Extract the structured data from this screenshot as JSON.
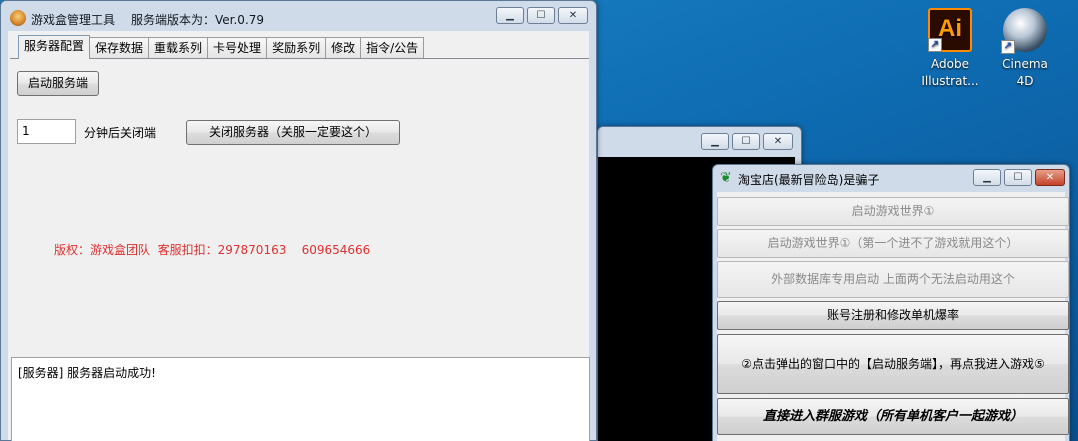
{
  "desktop": {
    "icons": [
      {
        "label": "Adobe Illustrat...",
        "glyph": "Ai"
      },
      {
        "label": "Cinema 4D"
      }
    ]
  },
  "main_window": {
    "title": "游戏盒管理工具",
    "version": "服务端版本为：Ver.0.79",
    "controls": {
      "minimize": "▁",
      "maximize": "☐",
      "close": "✕"
    },
    "tabs": [
      "服务器配置",
      "保存数据",
      "重载系列",
      "卡号处理",
      "奖励系列",
      "修改",
      "指令/公告"
    ],
    "start_button": "启动服务端",
    "shutdown_minutes": "1",
    "shutdown_label": "分钟后关闭端",
    "close_button": "关闭服务器（关服一定要这个）",
    "copyright": "版权：游戏盒团队  客服扣扣：297870163    609654666",
    "log": "[服务器] 服务器启动成功!"
  },
  "bg_window": {
    "controls": {
      "minimize": "▁",
      "maximize": "☐",
      "close": "✕"
    }
  },
  "launcher": {
    "title": "淘宝店(最新冒险岛)是骗子",
    "controls": {
      "minimize": "▁",
      "maximize": "☐",
      "close": "✕"
    },
    "buttons": [
      "启动游戏世界①",
      "启动游戏世界①（第一个进不了游戏就用这个）",
      "外部数据库专用启动  上面两个无法启动用这个",
      "账号注册和修改单机爆率",
      "②点击弹出的窗口中的【启动服务端】，再点我进入游戏⑤",
      "直接进入群服游戏（所有单机客户一起游戏）"
    ]
  },
  "colors": {
    "accent_red": "#e03030",
    "desktop_blue": "#0f6db3"
  }
}
